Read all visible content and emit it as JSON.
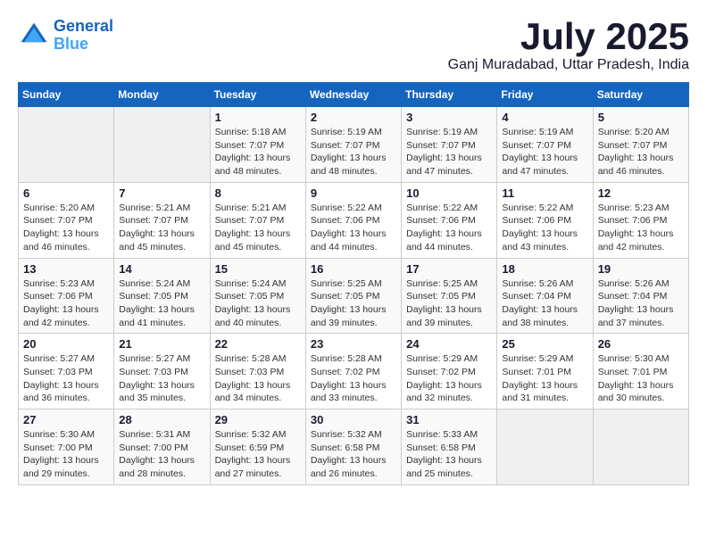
{
  "header": {
    "logo_line1": "General",
    "logo_line2": "Blue",
    "month_title": "July 2025",
    "location": "Ganj Muradabad, Uttar Pradesh, India"
  },
  "weekdays": [
    "Sunday",
    "Monday",
    "Tuesday",
    "Wednesday",
    "Thursday",
    "Friday",
    "Saturday"
  ],
  "weeks": [
    [
      {
        "day": "",
        "info": ""
      },
      {
        "day": "",
        "info": ""
      },
      {
        "day": "1",
        "info": "Sunrise: 5:18 AM\nSunset: 7:07 PM\nDaylight: 13 hours and 48 minutes."
      },
      {
        "day": "2",
        "info": "Sunrise: 5:19 AM\nSunset: 7:07 PM\nDaylight: 13 hours and 48 minutes."
      },
      {
        "day": "3",
        "info": "Sunrise: 5:19 AM\nSunset: 7:07 PM\nDaylight: 13 hours and 47 minutes."
      },
      {
        "day": "4",
        "info": "Sunrise: 5:19 AM\nSunset: 7:07 PM\nDaylight: 13 hours and 47 minutes."
      },
      {
        "day": "5",
        "info": "Sunrise: 5:20 AM\nSunset: 7:07 PM\nDaylight: 13 hours and 46 minutes."
      }
    ],
    [
      {
        "day": "6",
        "info": "Sunrise: 5:20 AM\nSunset: 7:07 PM\nDaylight: 13 hours and 46 minutes."
      },
      {
        "day": "7",
        "info": "Sunrise: 5:21 AM\nSunset: 7:07 PM\nDaylight: 13 hours and 45 minutes."
      },
      {
        "day": "8",
        "info": "Sunrise: 5:21 AM\nSunset: 7:07 PM\nDaylight: 13 hours and 45 minutes."
      },
      {
        "day": "9",
        "info": "Sunrise: 5:22 AM\nSunset: 7:06 PM\nDaylight: 13 hours and 44 minutes."
      },
      {
        "day": "10",
        "info": "Sunrise: 5:22 AM\nSunset: 7:06 PM\nDaylight: 13 hours and 44 minutes."
      },
      {
        "day": "11",
        "info": "Sunrise: 5:22 AM\nSunset: 7:06 PM\nDaylight: 13 hours and 43 minutes."
      },
      {
        "day": "12",
        "info": "Sunrise: 5:23 AM\nSunset: 7:06 PM\nDaylight: 13 hours and 42 minutes."
      }
    ],
    [
      {
        "day": "13",
        "info": "Sunrise: 5:23 AM\nSunset: 7:06 PM\nDaylight: 13 hours and 42 minutes."
      },
      {
        "day": "14",
        "info": "Sunrise: 5:24 AM\nSunset: 7:05 PM\nDaylight: 13 hours and 41 minutes."
      },
      {
        "day": "15",
        "info": "Sunrise: 5:24 AM\nSunset: 7:05 PM\nDaylight: 13 hours and 40 minutes."
      },
      {
        "day": "16",
        "info": "Sunrise: 5:25 AM\nSunset: 7:05 PM\nDaylight: 13 hours and 39 minutes."
      },
      {
        "day": "17",
        "info": "Sunrise: 5:25 AM\nSunset: 7:05 PM\nDaylight: 13 hours and 39 minutes."
      },
      {
        "day": "18",
        "info": "Sunrise: 5:26 AM\nSunset: 7:04 PM\nDaylight: 13 hours and 38 minutes."
      },
      {
        "day": "19",
        "info": "Sunrise: 5:26 AM\nSunset: 7:04 PM\nDaylight: 13 hours and 37 minutes."
      }
    ],
    [
      {
        "day": "20",
        "info": "Sunrise: 5:27 AM\nSunset: 7:03 PM\nDaylight: 13 hours and 36 minutes."
      },
      {
        "day": "21",
        "info": "Sunrise: 5:27 AM\nSunset: 7:03 PM\nDaylight: 13 hours and 35 minutes."
      },
      {
        "day": "22",
        "info": "Sunrise: 5:28 AM\nSunset: 7:03 PM\nDaylight: 13 hours and 34 minutes."
      },
      {
        "day": "23",
        "info": "Sunrise: 5:28 AM\nSunset: 7:02 PM\nDaylight: 13 hours and 33 minutes."
      },
      {
        "day": "24",
        "info": "Sunrise: 5:29 AM\nSunset: 7:02 PM\nDaylight: 13 hours and 32 minutes."
      },
      {
        "day": "25",
        "info": "Sunrise: 5:29 AM\nSunset: 7:01 PM\nDaylight: 13 hours and 31 minutes."
      },
      {
        "day": "26",
        "info": "Sunrise: 5:30 AM\nSunset: 7:01 PM\nDaylight: 13 hours and 30 minutes."
      }
    ],
    [
      {
        "day": "27",
        "info": "Sunrise: 5:30 AM\nSunset: 7:00 PM\nDaylight: 13 hours and 29 minutes."
      },
      {
        "day": "28",
        "info": "Sunrise: 5:31 AM\nSunset: 7:00 PM\nDaylight: 13 hours and 28 minutes."
      },
      {
        "day": "29",
        "info": "Sunrise: 5:32 AM\nSunset: 6:59 PM\nDaylight: 13 hours and 27 minutes."
      },
      {
        "day": "30",
        "info": "Sunrise: 5:32 AM\nSunset: 6:58 PM\nDaylight: 13 hours and 26 minutes."
      },
      {
        "day": "31",
        "info": "Sunrise: 5:33 AM\nSunset: 6:58 PM\nDaylight: 13 hours and 25 minutes."
      },
      {
        "day": "",
        "info": ""
      },
      {
        "day": "",
        "info": ""
      }
    ]
  ]
}
